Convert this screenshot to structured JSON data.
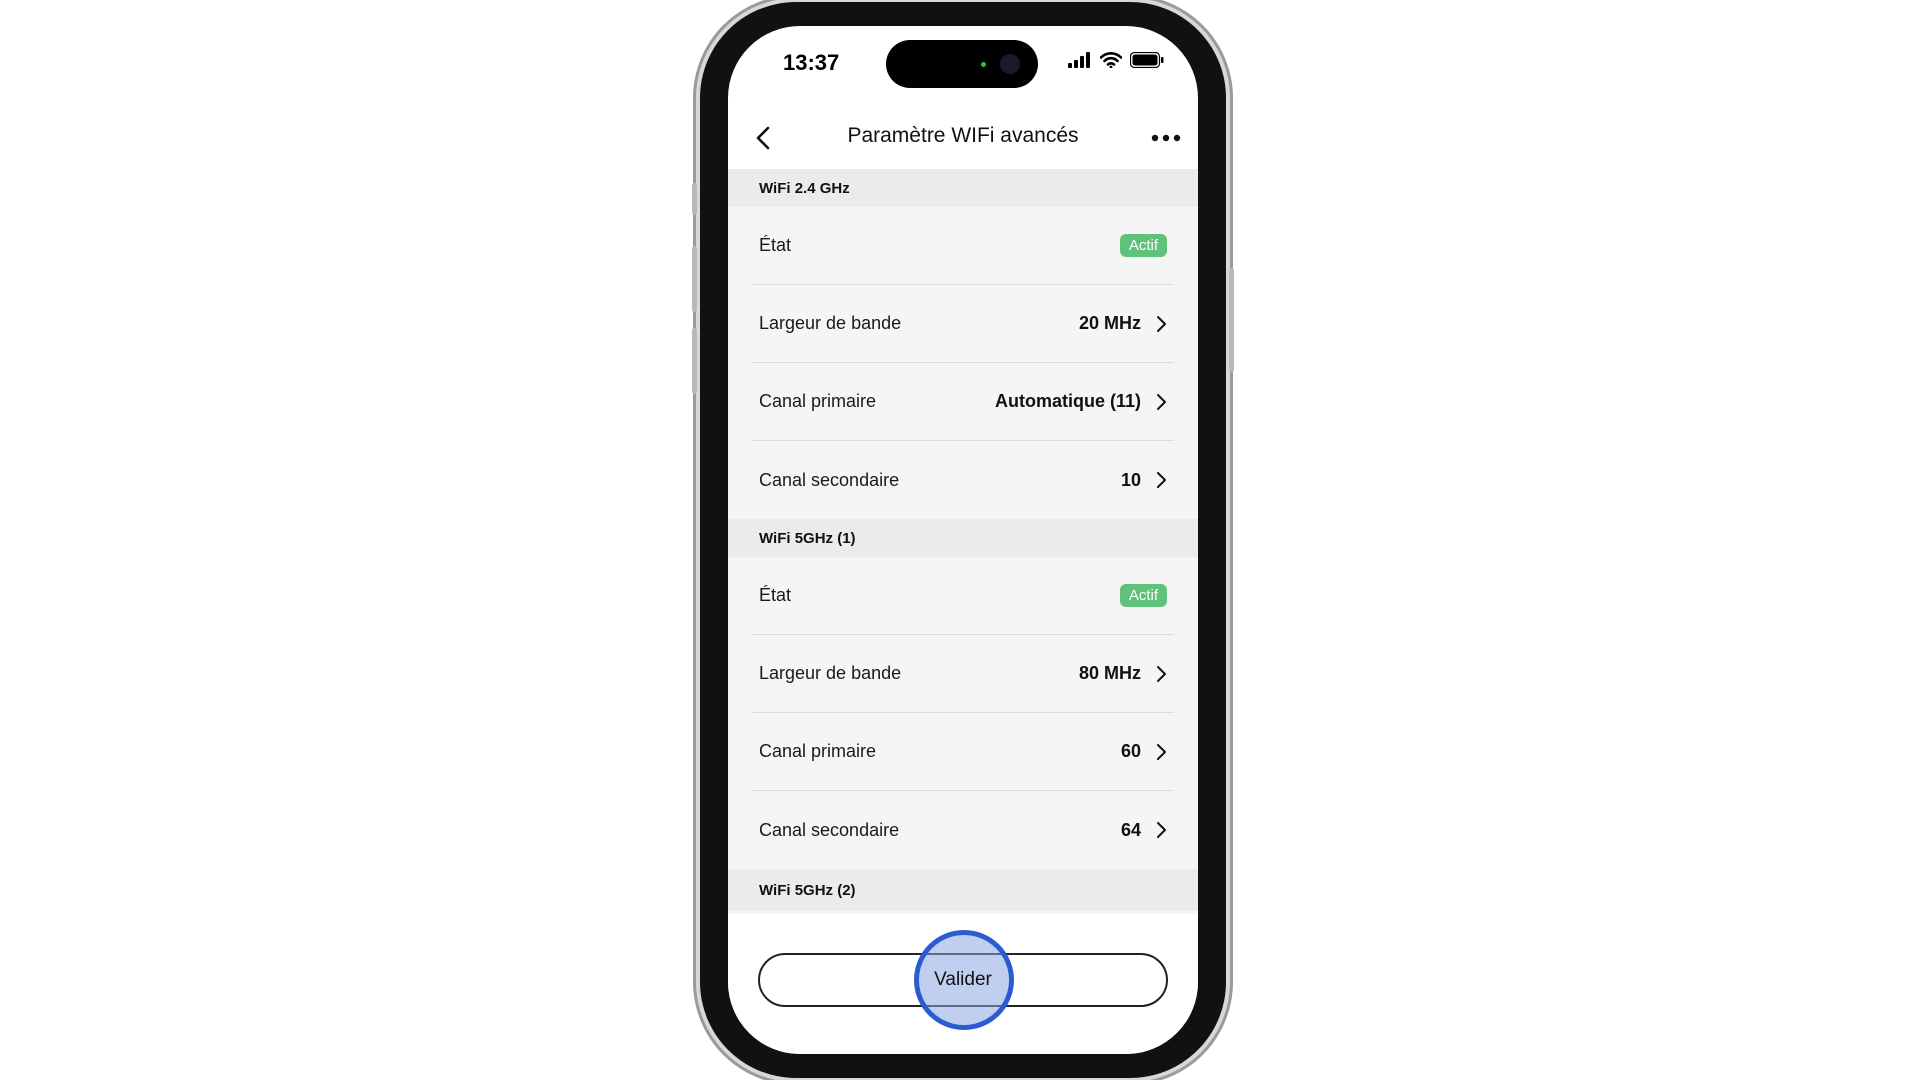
{
  "status_bar": {
    "time": "13:37",
    "icons": [
      "signal-icon",
      "wifi-icon",
      "battery-icon"
    ]
  },
  "nav": {
    "back_icon": "chevron-left-icon",
    "title": "Paramètre WIFi avancés",
    "more_icon": "more-horizontal-icon"
  },
  "sections": [
    {
      "title": "WiFi 2.4 GHz",
      "rows": [
        {
          "label": "État",
          "badge": "Actif"
        },
        {
          "label": "Largeur de bande",
          "value": "20 MHz"
        },
        {
          "label": "Canal primaire",
          "value": "Automatique (11)"
        },
        {
          "label": "Canal secondaire",
          "value": "10"
        }
      ]
    },
    {
      "title": "WiFi 5GHz (1)",
      "rows": [
        {
          "label": "État",
          "badge": "Actif"
        },
        {
          "label": "Largeur de bande",
          "value": "80 MHz"
        },
        {
          "label": "Canal primaire",
          "value": "60"
        },
        {
          "label": "Canal secondaire",
          "value": "64"
        }
      ]
    },
    {
      "title": "WiFi 5GHz (2)",
      "rows": []
    }
  ],
  "footer": {
    "validate_label": "Valider"
  },
  "colors": {
    "badge_green": "#5ec27a",
    "tap_ring": "#2a5bd0",
    "section_bg": "#ebebeb",
    "content_bg": "#f5f5f5"
  }
}
